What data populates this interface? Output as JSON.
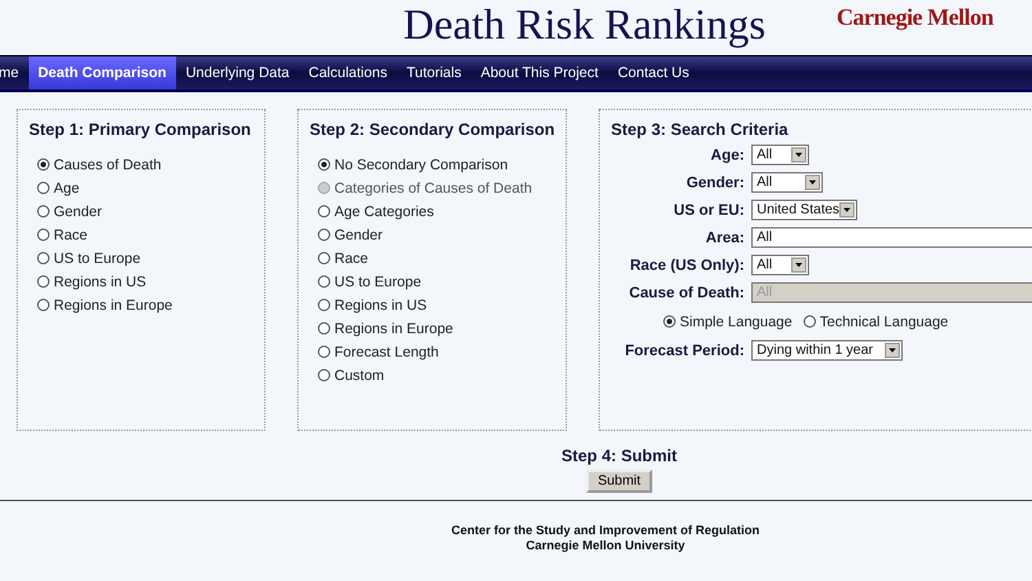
{
  "header": {
    "title": "Death Risk Rankings",
    "logo": "Carnegie Mellon"
  },
  "nav": [
    {
      "label": "me",
      "selected": false
    },
    {
      "label": "Death Comparison",
      "selected": true
    },
    {
      "label": "Underlying Data",
      "selected": false
    },
    {
      "label": "Calculations",
      "selected": false
    },
    {
      "label": "Tutorials",
      "selected": false
    },
    {
      "label": "About This Project",
      "selected": false
    },
    {
      "label": "Contact Us",
      "selected": false
    }
  ],
  "step1": {
    "title": "Step 1: Primary Comparison",
    "options": [
      {
        "label": "Causes of Death",
        "selected": true
      },
      {
        "label": "Age",
        "selected": false
      },
      {
        "label": "Gender",
        "selected": false
      },
      {
        "label": "Race",
        "selected": false
      },
      {
        "label": "US to Europe",
        "selected": false
      },
      {
        "label": "Regions in US",
        "selected": false
      },
      {
        "label": "Regions in Europe",
        "selected": false
      }
    ]
  },
  "step2": {
    "title": "Step 2: Secondary Comparison",
    "options": [
      {
        "label": "No Secondary Comparison",
        "selected": true,
        "disabled": false
      },
      {
        "label": "Categories of Causes of Death",
        "selected": false,
        "disabled": true
      },
      {
        "label": "Age Categories",
        "selected": false,
        "disabled": false
      },
      {
        "label": "Gender",
        "selected": false,
        "disabled": false
      },
      {
        "label": "Race",
        "selected": false,
        "disabled": false
      },
      {
        "label": "US to Europe",
        "selected": false,
        "disabled": false
      },
      {
        "label": "Regions in US",
        "selected": false,
        "disabled": false
      },
      {
        "label": "Regions in Europe",
        "selected": false,
        "disabled": false
      },
      {
        "label": "Forecast Length",
        "selected": false,
        "disabled": false
      },
      {
        "label": "Custom",
        "selected": false,
        "disabled": false
      }
    ]
  },
  "step3": {
    "title": "Step 3: Search Criteria",
    "rows": [
      {
        "kind": "select",
        "label": "Age:",
        "value": "All",
        "disabled": false
      },
      {
        "kind": "select",
        "label": "Gender:",
        "value": "All",
        "disabled": false
      },
      {
        "kind": "select",
        "label": "US or EU:",
        "value": "United States",
        "disabled": false
      },
      {
        "kind": "select",
        "label": "Area:",
        "value": "All",
        "disabled": false
      },
      {
        "kind": "select",
        "label": "Race (US Only):",
        "value": "All",
        "disabled": false
      },
      {
        "kind": "select",
        "label": "Cause of Death:",
        "value": "All",
        "disabled": true
      },
      {
        "kind": "radios",
        "options": [
          {
            "label": "Simple Language",
            "selected": true
          },
          {
            "label": "Technical Language",
            "selected": false
          }
        ]
      },
      {
        "kind": "select",
        "label": "Forecast Period:",
        "value": "Dying within 1 year",
        "disabled": false
      }
    ]
  },
  "step4": {
    "title": "Step 4: Submit",
    "button": "Submit"
  },
  "footer": [
    "Center for the Study and Improvement of Regulation",
    "Carnegie Mellon University"
  ]
}
